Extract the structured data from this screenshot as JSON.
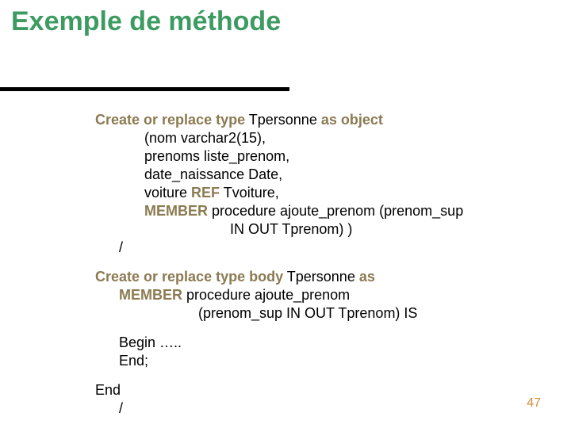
{
  "title": "Exemple de méthode",
  "code": {
    "l1_kw1": "Create or replace type",
    "l1_txt1": " Tpersonne ",
    "l1_kw2": "as object",
    "l2": "(nom varchar2(15),",
    "l3": "prenoms liste_prenom,",
    "l4": "date_naissance Date,",
    "l5a": "voiture ",
    "l5_kw": "REF",
    "l5b": " Tvoiture,",
    "l6_kw": "MEMBER",
    "l6b": " procedure ajoute_prenom (prenom_sup",
    "l7": "IN OUT Tprenom) )",
    "l8": "/",
    "l9_kw1": "Create or replace type body",
    "l9_txt1": " Tpersonne ",
    "l9_kw2": "as",
    "l10_kw": "MEMBER",
    "l10b": " procedure ajoute_prenom",
    "l11": "(prenom_sup IN OUT Tprenom)  IS",
    "l12": "Begin …..",
    "l13": "End;",
    "l14": "End",
    "l15": "/"
  },
  "pagenum": "47"
}
